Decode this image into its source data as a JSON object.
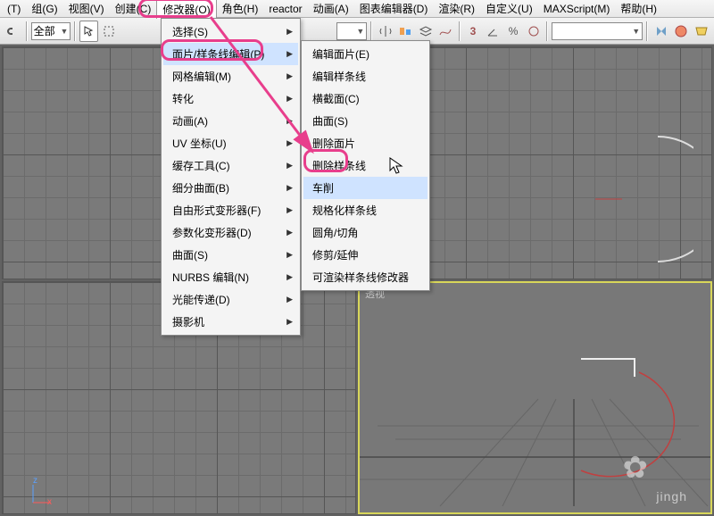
{
  "menubar": {
    "items": [
      {
        "label": "(T)"
      },
      {
        "label": "组(G)"
      },
      {
        "label": "视图(V)"
      },
      {
        "label": "创建(C)"
      },
      {
        "label": "修改器(O)"
      },
      {
        "label": "角色(H)"
      },
      {
        "label": "reactor"
      },
      {
        "label": "动画(A)"
      },
      {
        "label": "图表编辑器(D)"
      },
      {
        "label": "渲染(R)"
      },
      {
        "label": "自定义(U)"
      },
      {
        "label": "MAXScript(M)"
      },
      {
        "label": "帮助(H)"
      }
    ]
  },
  "toolbar": {
    "selection_set": "全部",
    "named_set": "",
    "blank_set": ""
  },
  "dropdown_menu": {
    "items": [
      {
        "label": "选择(S)"
      },
      {
        "label": "面片/样条线编辑(P)"
      },
      {
        "label": "网格编辑(M)"
      },
      {
        "label": "转化"
      },
      {
        "label": "动画(A)"
      },
      {
        "label": "UV 坐标(U)"
      },
      {
        "label": "缓存工具(C)"
      },
      {
        "label": "细分曲面(B)"
      },
      {
        "label": "自由形式变形器(F)"
      },
      {
        "label": "参数化变形器(D)"
      },
      {
        "label": "曲面(S)"
      },
      {
        "label": "NURBS 编辑(N)"
      },
      {
        "label": "光能传递(D)"
      },
      {
        "label": "摄影机"
      }
    ]
  },
  "submenu": {
    "items": [
      {
        "label": "编辑面片(E)"
      },
      {
        "label": "编辑样条线"
      },
      {
        "label": "横截面(C)"
      },
      {
        "label": "曲面(S)"
      },
      {
        "label": "删除面片"
      },
      {
        "label": "删除样条线"
      },
      {
        "label": "车削"
      },
      {
        "label": "规格化样条线"
      },
      {
        "label": "圆角/切角"
      },
      {
        "label": "修剪/延伸"
      },
      {
        "label": "可渲染样条线修改器"
      }
    ]
  },
  "viewport": {
    "perspective_label": "透视"
  },
  "watermark": "jingh"
}
